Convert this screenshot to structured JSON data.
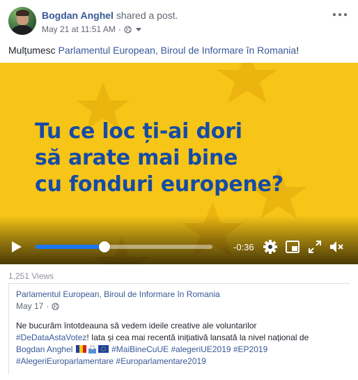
{
  "post": {
    "author": "Bogdan Anghel",
    "action": "shared a post.",
    "timestamp": "May 21 at 11:51 AM",
    "separator": "·",
    "text_prefix": "Mulțumesc ",
    "text_link": "Parlamentul European, Biroul de Informare în Romania",
    "text_suffix": "!"
  },
  "video": {
    "headline": [
      "Tu ce loc ți-ai dori",
      "să arate mai bine",
      "cu fonduri europene?"
    ],
    "time_remaining": "-0:36",
    "progress": 0.39,
    "colors": {
      "background": "#f7c517",
      "headline": "#164ba6",
      "progress": "#1a77f2"
    }
  },
  "stats": {
    "views": "1,251 Views"
  },
  "shared_post": {
    "page_name": "Parlamentul European, Biroul de Informare în Romania",
    "date": "May 17",
    "separator": "·",
    "line1": "Ne bucurăm întotdeauna să vedem ideile creative ale voluntarilor",
    "line2_tag": "#DeDataAstaVotez",
    "line2_rest": "! Iata și cea mai recentă inițiativă lansată la nivel național de",
    "line3_name": "Bogdan Anghel",
    "line3_tags": "#MaiBineCuUE #alegeriUE2019 #EP2019",
    "line4_tags": "#AlegeriEuroparlamentare #Europarlamentare2019"
  },
  "icons": {
    "privacy": "globe-icon",
    "audience": "chevron-down-icon",
    "more": "more-options-icon",
    "play": "play-icon",
    "settings": "gear-icon",
    "pip": "picture-in-picture-icon",
    "fullscreen": "fullscreen-icon",
    "volume": "muted-volume-icon"
  }
}
